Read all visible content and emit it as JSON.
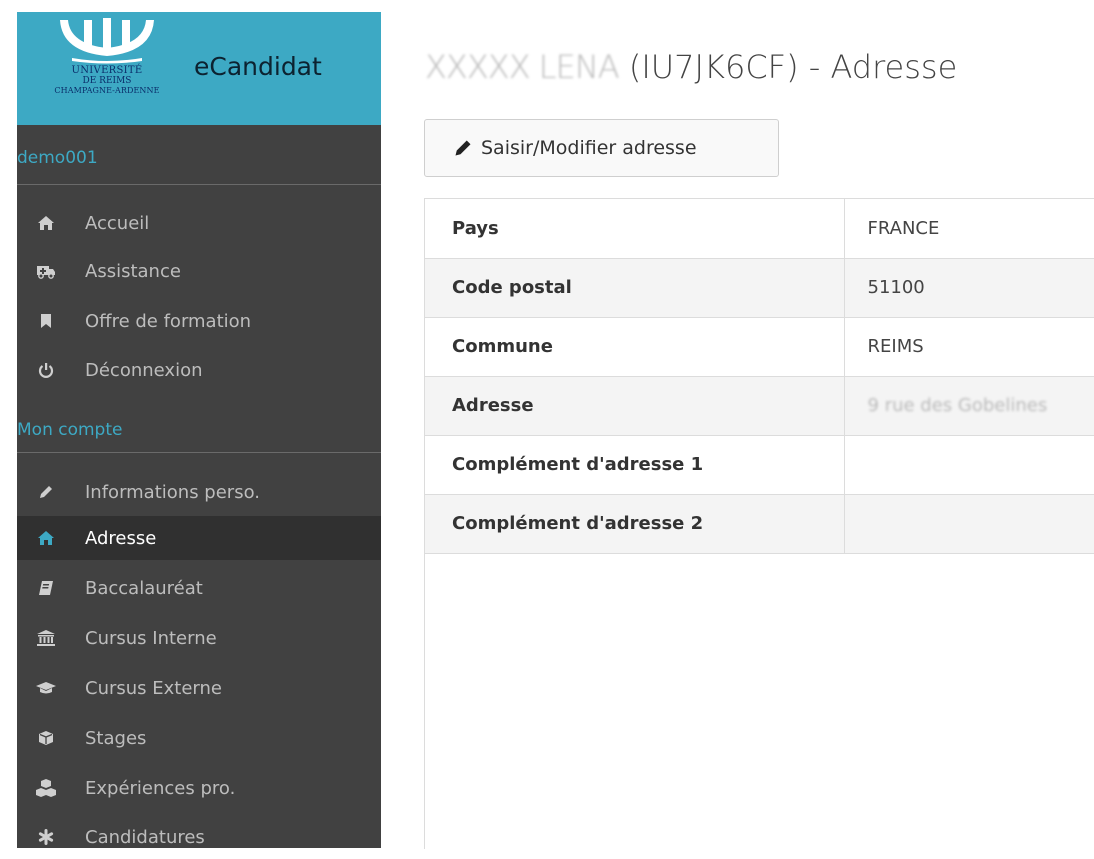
{
  "brand": {
    "logo_line1": "UNIVERSITÉ",
    "logo_line2": "DE REIMS",
    "logo_line3": "CHAMPAGNE-ARDENNE",
    "app_name": "eCandidat",
    "accent_color": "#3da9c4"
  },
  "sidebar": {
    "user": "demo001",
    "main_items": [
      {
        "label": "Accueil",
        "icon": "home-icon"
      },
      {
        "label": "Assistance",
        "icon": "ambulance-icon"
      },
      {
        "label": "Offre de formation",
        "icon": "bookmark-icon"
      },
      {
        "label": "Déconnexion",
        "icon": "power-icon"
      }
    ],
    "section_title": "Mon compte",
    "account_items": [
      {
        "label": "Informations perso.",
        "icon": "pencil-icon"
      },
      {
        "label": "Adresse",
        "icon": "home-icon",
        "active": true
      },
      {
        "label": "Baccalauréat",
        "icon": "book-icon"
      },
      {
        "label": "Cursus Interne",
        "icon": "university-icon"
      },
      {
        "label": "Cursus Externe",
        "icon": "graduation-cap-icon"
      },
      {
        "label": "Stages",
        "icon": "cube-icon"
      },
      {
        "label": "Expériences pro.",
        "icon": "cubes-icon"
      },
      {
        "label": "Candidatures",
        "icon": "asterisk-icon"
      }
    ]
  },
  "main": {
    "title_name": "XXXXX LENA",
    "title_rest": "(IU7JK6CF) - Adresse",
    "edit_button": "Saisir/Modifier adresse",
    "rows": [
      {
        "label": "Pays",
        "value": "FRANCE"
      },
      {
        "label": "Code postal",
        "value": "51100"
      },
      {
        "label": "Commune",
        "value": "REIMS"
      },
      {
        "label": "Adresse",
        "value": "9 rue des Gobelines"
      },
      {
        "label": "Complément d'adresse 1",
        "value": ""
      },
      {
        "label": "Complément d'adresse 2",
        "value": ""
      }
    ]
  }
}
